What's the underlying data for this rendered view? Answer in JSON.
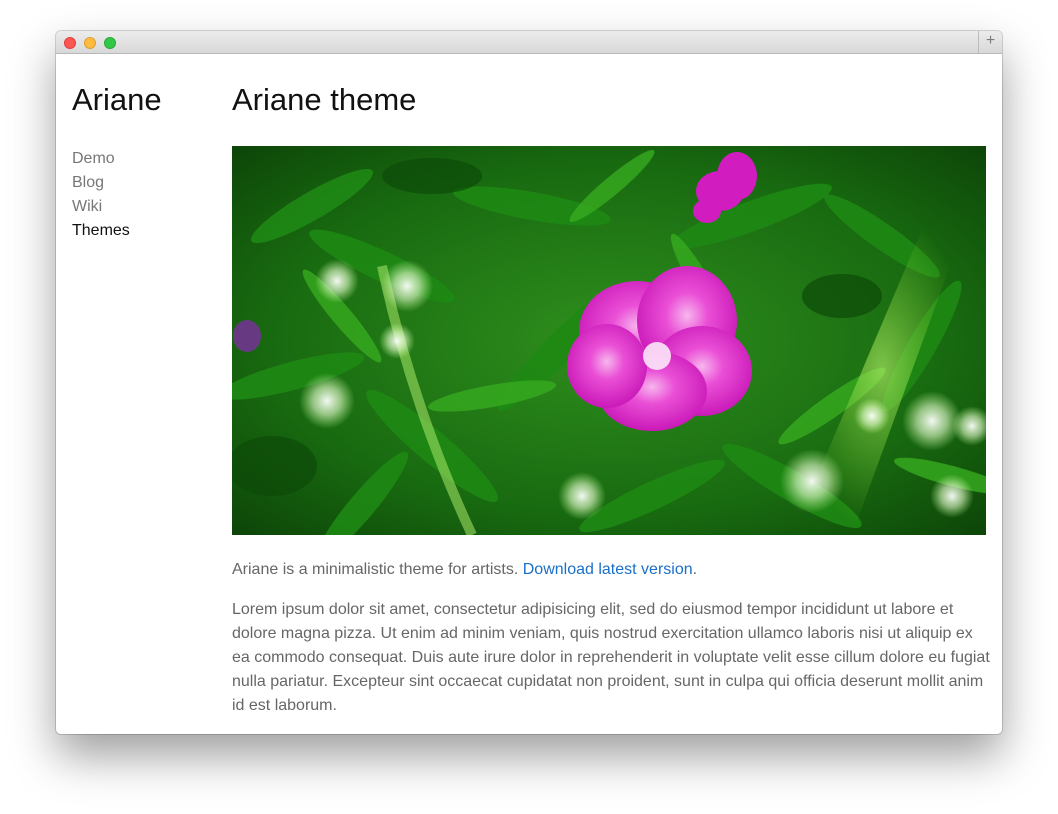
{
  "window": {
    "colors": {
      "close": "#fc5753",
      "minimize": "#fdbc40",
      "maximize": "#33c748"
    },
    "new_tab_symbol": "+"
  },
  "sidebar": {
    "site_title": "Ariane",
    "nav": [
      {
        "label": "Demo",
        "active": false
      },
      {
        "label": "Blog",
        "active": false
      },
      {
        "label": "Wiki",
        "active": false
      },
      {
        "label": "Themes",
        "active": true
      }
    ]
  },
  "main": {
    "title": "Ariane theme",
    "intro_text": "Ariane is a minimalistic theme for artists. ",
    "download_link": "Download latest version",
    "intro_end": ".",
    "body": "Lorem ipsum dolor sit amet, consectetur adipisicing elit, sed do eiusmod tempor incididunt ut labore et dolore magna pizza. Ut enim ad minim veniam, quis nostrud exercitation ullamco laboris nisi ut aliquip ex ea commodo consequat. Duis aute irure dolor in reprehenderit in voluptate velit esse cillum dolore eu fugiat nulla pariatur. Excepteur sint occaecat cupidatat non proident, sunt in culpa qui officia deserunt mollit anim id est laborum.",
    "link_color": "#1a6fc9"
  }
}
